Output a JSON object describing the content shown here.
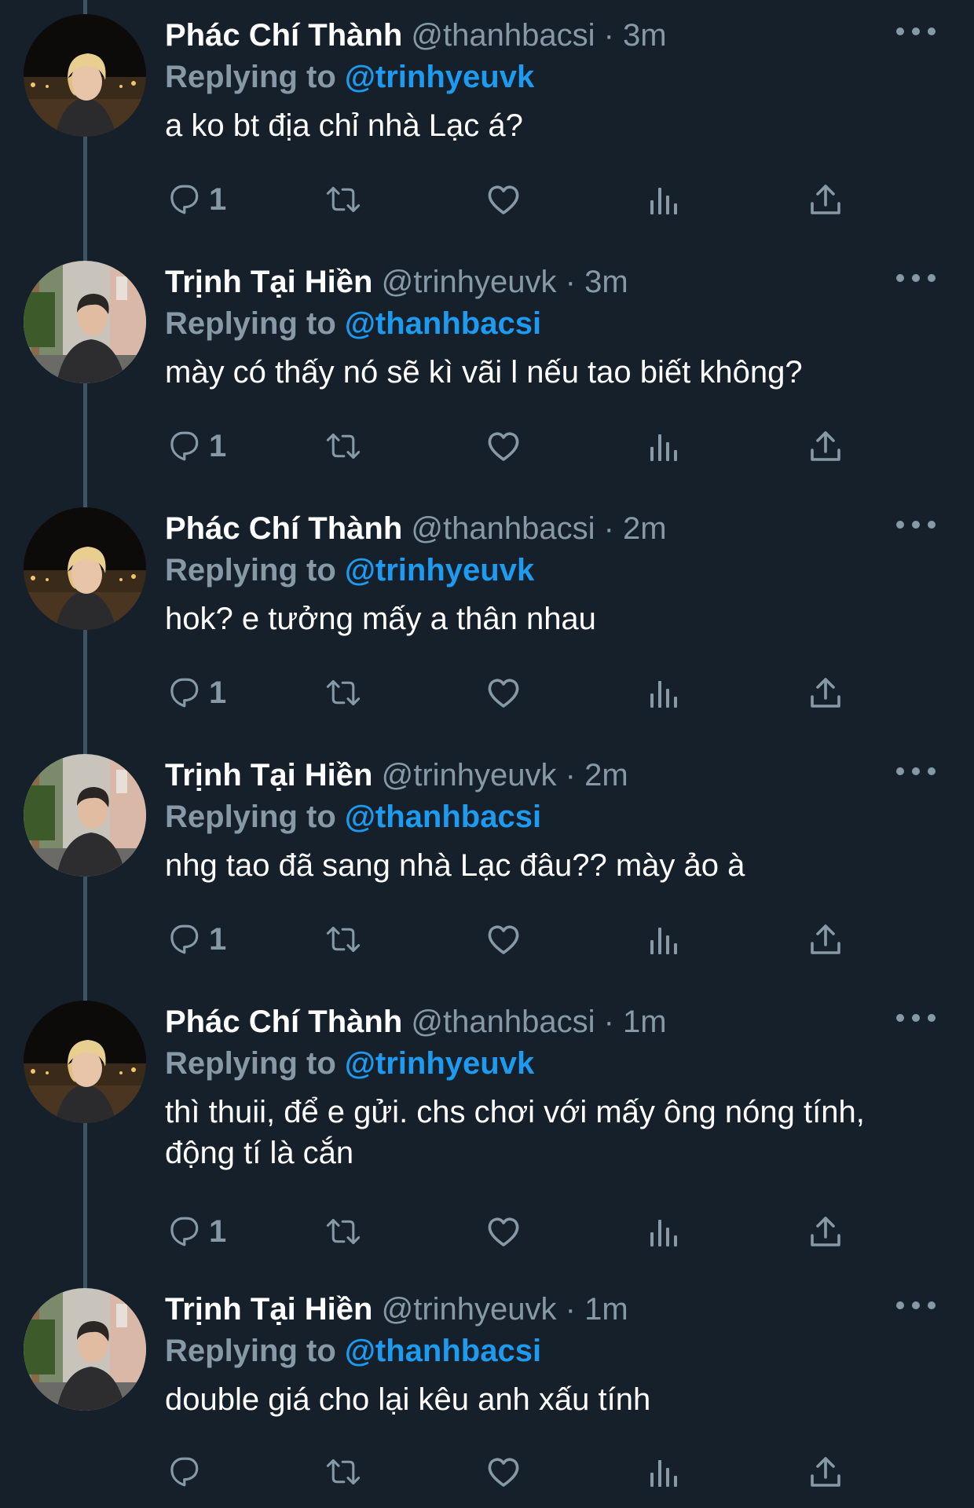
{
  "users": {
    "thanh": {
      "display_name": "Phác Chí Thành",
      "handle": "@thanhbacsi"
    },
    "hien": {
      "display_name": "Trịnh Tại Hiền",
      "handle": "@trinhyeuvk"
    }
  },
  "replying_prefix": "Replying to",
  "separator": "·",
  "colors": {
    "background": "#15202b",
    "secondary_text": "#8899a6",
    "accent": "#1d9bf0"
  },
  "icons": {
    "more": "more-horizontal-icon",
    "reply": "reply-bubble-icon",
    "retweet": "retweet-icon",
    "like": "heart-icon",
    "views": "views-bar-chart-icon",
    "share": "share-upload-icon"
  },
  "tweets": [
    {
      "author": "Phác Chí Thành",
      "handle": "@thanhbacsi",
      "time": "3m",
      "replying_to": "@trinhyeuvk",
      "text": "a ko bt địa chỉ nhà Lạc á?",
      "reply_count": "1"
    },
    {
      "author": "Trịnh Tại Hiền",
      "handle": "@trinhyeuvk",
      "time": "3m",
      "replying_to": "@thanhbacsi",
      "text": "mày có thấy nó sẽ kì vãi l nếu tao biết không?",
      "reply_count": "1"
    },
    {
      "author": "Phác Chí Thành",
      "handle": "@thanhbacsi",
      "time": "2m",
      "replying_to": "@trinhyeuvk",
      "text": "hok? e tưởng mấy a thân nhau",
      "reply_count": "1"
    },
    {
      "author": "Trịnh Tại Hiền",
      "handle": "@trinhyeuvk",
      "time": "2m",
      "replying_to": "@thanhbacsi",
      "text": "nhg tao đã sang nhà Lạc đâu?? mày ảo à",
      "reply_count": "1"
    },
    {
      "author": "Phác Chí Thành",
      "handle": "@thanhbacsi",
      "time": "1m",
      "replying_to": "@trinhyeuvk",
      "text": "thì thuii, để e gửi. chs chơi với mấy ông nóng tính, động tí là cắn",
      "reply_count": "1"
    },
    {
      "author": "Trịnh Tại Hiền",
      "handle": "@trinhyeuvk",
      "time": "1m",
      "replying_to": "@thanhbacsi",
      "text": "double giá cho lại kêu anh xấu tính",
      "reply_count": ""
    }
  ]
}
